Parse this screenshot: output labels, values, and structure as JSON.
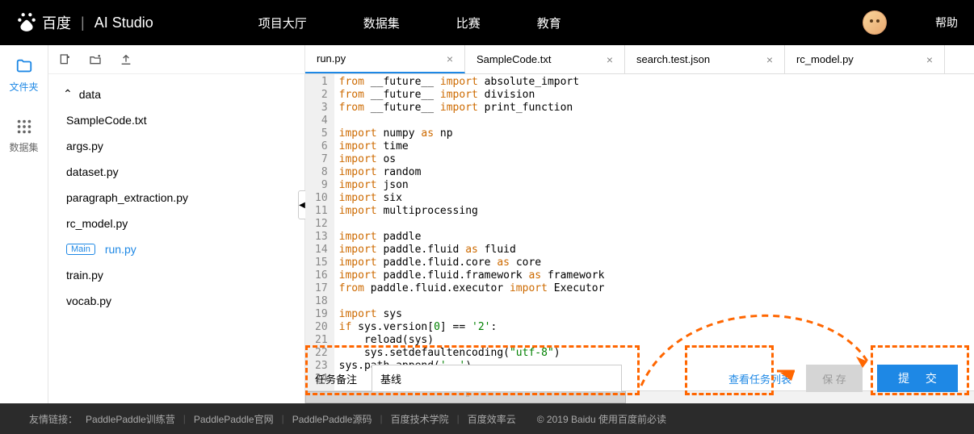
{
  "header": {
    "brand_baidu": "百度",
    "brand_studio": "AI Studio",
    "nav": [
      "项目大厅",
      "数据集",
      "比赛",
      "教育"
    ],
    "help": "帮助"
  },
  "rail": {
    "files": "文件夹",
    "datasets": "数据集"
  },
  "tree": {
    "folder": "data",
    "items": [
      "SampleCode.txt",
      "args.py",
      "dataset.py",
      "paragraph_extraction.py",
      "rc_model.py",
      "run.py",
      "train.py",
      "vocab.py"
    ],
    "main_badge": "Main",
    "main_file": "run.py"
  },
  "tabs": [
    {
      "label": "run.py",
      "active": true
    },
    {
      "label": "SampleCode.txt",
      "active": false
    },
    {
      "label": "search.test.json",
      "active": false
    },
    {
      "label": "rc_model.py",
      "active": false
    }
  ],
  "code": {
    "lines": [
      [
        [
          "kw-orange",
          "from"
        ],
        [
          "",
          " __future__ "
        ],
        [
          "kw-orange",
          "import"
        ],
        [
          "",
          " absolute_import"
        ]
      ],
      [
        [
          "kw-orange",
          "from"
        ],
        [
          "",
          " __future__ "
        ],
        [
          "kw-orange",
          "import"
        ],
        [
          "",
          " division"
        ]
      ],
      [
        [
          "kw-orange",
          "from"
        ],
        [
          "",
          " __future__ "
        ],
        [
          "kw-orange",
          "import"
        ],
        [
          "",
          " print_function"
        ]
      ],
      [],
      [
        [
          "kw-orange",
          "import"
        ],
        [
          "",
          " numpy "
        ],
        [
          "kw-orange",
          "as"
        ],
        [
          "",
          " np"
        ]
      ],
      [
        [
          "kw-orange",
          "import"
        ],
        [
          "",
          " time"
        ]
      ],
      [
        [
          "kw-orange",
          "import"
        ],
        [
          "",
          " os"
        ]
      ],
      [
        [
          "kw-orange",
          "import"
        ],
        [
          "",
          " random"
        ]
      ],
      [
        [
          "kw-orange",
          "import"
        ],
        [
          "",
          " json"
        ]
      ],
      [
        [
          "kw-orange",
          "import"
        ],
        [
          "",
          " six"
        ]
      ],
      [
        [
          "kw-orange",
          "import"
        ],
        [
          "",
          " multiprocessing"
        ]
      ],
      [],
      [
        [
          "kw-orange",
          "import"
        ],
        [
          "",
          " paddle"
        ]
      ],
      [
        [
          "kw-orange",
          "import"
        ],
        [
          "",
          " paddle.fluid "
        ],
        [
          "kw-orange",
          "as"
        ],
        [
          "",
          " fluid"
        ]
      ],
      [
        [
          "kw-orange",
          "import"
        ],
        [
          "",
          " paddle.fluid.core "
        ],
        [
          "kw-orange",
          "as"
        ],
        [
          "",
          " core"
        ]
      ],
      [
        [
          "kw-orange",
          "import"
        ],
        [
          "",
          " paddle.fluid.framework "
        ],
        [
          "kw-orange",
          "as"
        ],
        [
          "",
          " framework"
        ]
      ],
      [
        [
          "kw-orange",
          "from"
        ],
        [
          "",
          " paddle.fluid.executor "
        ],
        [
          "kw-orange",
          "import"
        ],
        [
          "",
          " Executor"
        ]
      ],
      [],
      [
        [
          "kw-orange",
          "import"
        ],
        [
          "",
          " sys"
        ]
      ],
      [
        [
          "kw-orange",
          "if"
        ],
        [
          "",
          " sys.version["
        ],
        [
          "kw-num",
          "0"
        ],
        [
          "",
          "] == "
        ],
        [
          "kw-str",
          "'2'"
        ],
        [
          "",
          ":"
        ]
      ],
      [
        [
          "",
          "    reload(sys)"
        ]
      ],
      [
        [
          "",
          "    sys.setdefaultencoding("
        ],
        [
          "kw-str",
          "\"utf-8\""
        ],
        [
          "",
          ")"
        ]
      ],
      [
        [
          "",
          "sys.path.append("
        ],
        [
          "kw-str",
          "'..'"
        ],
        [
          "",
          ")"
        ]
      ],
      []
    ]
  },
  "bottom": {
    "task_label": "任务备注",
    "task_value": "基线",
    "view_tasks": "查看任务列表",
    "save": "保 存",
    "submit": "提 交"
  },
  "footer": {
    "prefix": "友情链接：",
    "links": [
      "PaddlePaddle训练营",
      "PaddlePaddle官网",
      "PaddlePaddle源码",
      "百度技术学院",
      "百度效率云"
    ],
    "copyright": "© 2019 Baidu 使用百度前必读"
  }
}
